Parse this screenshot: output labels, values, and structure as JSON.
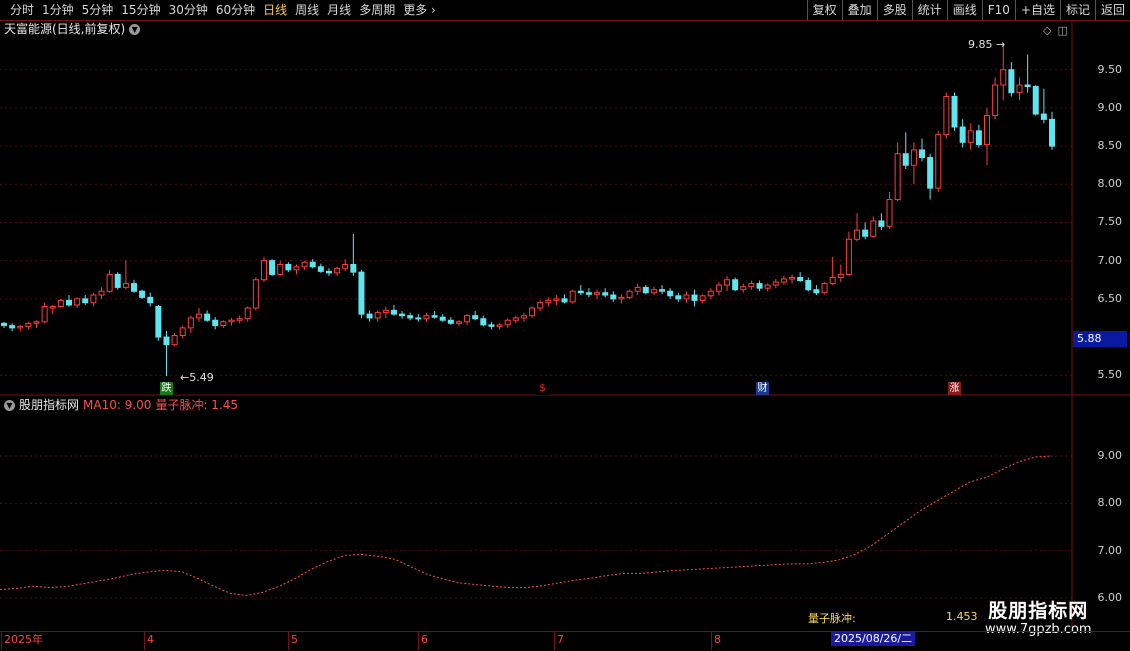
{
  "toolbar": {
    "periods": [
      "分时",
      "1分钟",
      "5分钟",
      "15分钟",
      "30分钟",
      "60分钟",
      "日线",
      "周线",
      "月线",
      "多周期",
      "更多"
    ],
    "active_period": "日线",
    "right_buttons": [
      "复权",
      "叠加",
      "多股",
      "统计",
      "画线",
      "F10",
      "+自选",
      "标记",
      "返回"
    ]
  },
  "chart_header": {
    "title": "天富能源(日线,前复权)"
  },
  "indicator_header": {
    "name": "股朋指标网",
    "ma_label": "MA10: 9.00",
    "qz_label": "量子脉冲: 1.45"
  },
  "price_axis": [
    "9.50",
    "9.00",
    "8.50",
    "8.00",
    "7.50",
    "7.00",
    "6.50",
    "5.50"
  ],
  "indicator_axis": [
    "9.00",
    "8.00",
    "7.00",
    "6.00"
  ],
  "last_price_box": "5.88",
  "annotations": {
    "high": "9.85",
    "low": "5.49"
  },
  "badges": [
    {
      "text": "跌",
      "bg": "#1a7a1a",
      "color": "#ffffff"
    },
    {
      "text": "$",
      "bg": "#000000",
      "color": "#ff3030"
    },
    {
      "text": "财",
      "bg": "#1a3a8a",
      "color": "#ffffff"
    },
    {
      "text": "涨",
      "bg": "#8a1a1a",
      "color": "#ffffff"
    }
  ],
  "date_axis": [
    "2025年",
    "4",
    "5",
    "6",
    "7",
    "8"
  ],
  "date_cursor": "2025/08/26/二",
  "qz_readout": {
    "label": "量子脉冲:",
    "value": "1.453"
  },
  "watermark": {
    "line1": "股朋指标网",
    "line2": "www.7gpzb.com"
  },
  "colors": {
    "up": "#ff3b3b",
    "down": "#5ee6f0",
    "ma": "#ff4d4d",
    "grid": "#5a0a0a"
  },
  "chart_data": {
    "type": "candlestick",
    "ohlc": [
      [
        6.18,
        6.2,
        6.12,
        6.15
      ],
      [
        6.15,
        6.18,
        6.08,
        6.12
      ],
      [
        6.12,
        6.16,
        6.08,
        6.14
      ],
      [
        6.14,
        6.2,
        6.1,
        6.18
      ],
      [
        6.18,
        6.22,
        6.12,
        6.2
      ],
      [
        6.2,
        6.45,
        6.18,
        6.4
      ],
      [
        6.38,
        6.42,
        6.3,
        6.4
      ],
      [
        6.4,
        6.5,
        6.38,
        6.48
      ],
      [
        6.48,
        6.55,
        6.4,
        6.42
      ],
      [
        6.42,
        6.52,
        6.38,
        6.5
      ],
      [
        6.5,
        6.55,
        6.42,
        6.45
      ],
      [
        6.45,
        6.58,
        6.4,
        6.55
      ],
      [
        6.55,
        6.65,
        6.5,
        6.6
      ],
      [
        6.6,
        6.88,
        6.58,
        6.82
      ],
      [
        6.82,
        6.85,
        6.62,
        6.65
      ],
      [
        6.65,
        7.0,
        6.62,
        6.7
      ],
      [
        6.7,
        6.75,
        6.58,
        6.6
      ],
      [
        6.6,
        6.62,
        6.5,
        6.52
      ],
      [
        6.52,
        6.58,
        6.4,
        6.45
      ],
      [
        6.4,
        6.42,
        5.95,
        6.0
      ],
      [
        6.0,
        6.08,
        5.49,
        5.9
      ],
      [
        5.9,
        6.05,
        5.88,
        6.02
      ],
      [
        6.02,
        6.15,
        5.98,
        6.12
      ],
      [
        6.12,
        6.28,
        6.05,
        6.25
      ],
      [
        6.25,
        6.38,
        6.2,
        6.3
      ],
      [
        6.3,
        6.35,
        6.2,
        6.22
      ],
      [
        6.22,
        6.26,
        6.1,
        6.15
      ],
      [
        6.15,
        6.22,
        6.12,
        6.2
      ],
      [
        6.2,
        6.25,
        6.15,
        6.22
      ],
      [
        6.22,
        6.28,
        6.18,
        6.24
      ],
      [
        6.24,
        6.4,
        6.2,
        6.38
      ],
      [
        6.38,
        6.78,
        6.35,
        6.75
      ],
      [
        6.75,
        7.05,
        6.72,
        7.0
      ],
      [
        7.0,
        7.02,
        6.8,
        6.82
      ],
      [
        6.82,
        7.0,
        6.8,
        6.95
      ],
      [
        6.95,
        6.98,
        6.85,
        6.88
      ],
      [
        6.88,
        6.95,
        6.82,
        6.92
      ],
      [
        6.92,
        7.0,
        6.88,
        6.98
      ],
      [
        6.98,
        7.02,
        6.9,
        6.92
      ],
      [
        6.92,
        6.96,
        6.84,
        6.86
      ],
      [
        6.86,
        6.9,
        6.8,
        6.84
      ],
      [
        6.84,
        6.92,
        6.8,
        6.9
      ],
      [
        6.9,
        7.02,
        6.86,
        6.95
      ],
      [
        6.95,
        7.35,
        6.8,
        6.85
      ],
      [
        6.85,
        6.88,
        6.25,
        6.3
      ],
      [
        6.3,
        6.35,
        6.2,
        6.25
      ],
      [
        6.25,
        6.35,
        6.2,
        6.32
      ],
      [
        6.32,
        6.4,
        6.25,
        6.35
      ],
      [
        6.35,
        6.42,
        6.28,
        6.3
      ],
      [
        6.3,
        6.34,
        6.24,
        6.28
      ],
      [
        6.28,
        6.32,
        6.22,
        6.25
      ],
      [
        6.25,
        6.3,
        6.2,
        6.24
      ],
      [
        6.24,
        6.32,
        6.2,
        6.28
      ],
      [
        6.28,
        6.34,
        6.24,
        6.26
      ],
      [
        6.26,
        6.3,
        6.2,
        6.22
      ],
      [
        6.22,
        6.26,
        6.16,
        6.18
      ],
      [
        6.18,
        6.22,
        6.14,
        6.2
      ],
      [
        6.2,
        6.3,
        6.16,
        6.28
      ],
      [
        6.28,
        6.34,
        6.22,
        6.24
      ],
      [
        6.24,
        6.28,
        6.14,
        6.16
      ],
      [
        6.16,
        6.2,
        6.1,
        6.14
      ],
      [
        6.14,
        6.18,
        6.1,
        6.16
      ],
      [
        6.16,
        6.24,
        6.12,
        6.22
      ],
      [
        6.22,
        6.28,
        6.18,
        6.25
      ],
      [
        6.25,
        6.32,
        6.2,
        6.28
      ],
      [
        6.28,
        6.4,
        6.25,
        6.38
      ],
      [
        6.38,
        6.48,
        6.34,
        6.45
      ],
      [
        6.45,
        6.52,
        6.4,
        6.48
      ],
      [
        6.48,
        6.55,
        6.42,
        6.5
      ],
      [
        6.5,
        6.56,
        6.44,
        6.46
      ],
      [
        6.46,
        6.62,
        6.44,
        6.6
      ],
      [
        6.6,
        6.68,
        6.55,
        6.58
      ],
      [
        6.58,
        6.64,
        6.52,
        6.56
      ],
      [
        6.56,
        6.62,
        6.5,
        6.58
      ],
      [
        6.58,
        6.64,
        6.52,
        6.55
      ],
      [
        6.55,
        6.6,
        6.46,
        6.5
      ],
      [
        6.5,
        6.56,
        6.44,
        6.52
      ],
      [
        6.52,
        6.62,
        6.5,
        6.6
      ],
      [
        6.6,
        6.7,
        6.55,
        6.65
      ],
      [
        6.65,
        6.68,
        6.56,
        6.58
      ],
      [
        6.58,
        6.66,
        6.55,
        6.62
      ],
      [
        6.62,
        6.68,
        6.56,
        6.6
      ],
      [
        6.6,
        6.64,
        6.5,
        6.54
      ],
      [
        6.54,
        6.58,
        6.46,
        6.5
      ],
      [
        6.5,
        6.6,
        6.45,
        6.55
      ],
      [
        6.55,
        6.62,
        6.4,
        6.48
      ],
      [
        6.48,
        6.56,
        6.44,
        6.54
      ],
      [
        6.54,
        6.64,
        6.5,
        6.6
      ],
      [
        6.6,
        6.72,
        6.55,
        6.68
      ],
      [
        6.68,
        6.8,
        6.6,
        6.75
      ],
      [
        6.75,
        6.78,
        6.6,
        6.62
      ],
      [
        6.62,
        6.7,
        6.58,
        6.66
      ],
      [
        6.66,
        6.74,
        6.62,
        6.7
      ],
      [
        6.7,
        6.74,
        6.6,
        6.64
      ],
      [
        6.64,
        6.7,
        6.6,
        6.68
      ],
      [
        6.68,
        6.76,
        6.64,
        6.72
      ],
      [
        6.72,
        6.8,
        6.68,
        6.76
      ],
      [
        6.76,
        6.82,
        6.7,
        6.78
      ],
      [
        6.78,
        6.85,
        6.72,
        6.74
      ],
      [
        6.74,
        6.78,
        6.6,
        6.62
      ],
      [
        6.62,
        6.68,
        6.55,
        6.58
      ],
      [
        6.58,
        6.72,
        6.56,
        6.7
      ],
      [
        6.7,
        7.05,
        6.68,
        6.78
      ],
      [
        6.78,
        6.95,
        6.72,
        6.82
      ],
      [
        6.82,
        7.38,
        6.8,
        7.28
      ],
      [
        7.28,
        7.62,
        7.25,
        7.4
      ],
      [
        7.4,
        7.5,
        7.28,
        7.32
      ],
      [
        7.32,
        7.58,
        7.3,
        7.52
      ],
      [
        7.52,
        7.62,
        7.4,
        7.45
      ],
      [
        7.45,
        7.9,
        7.42,
        7.8
      ],
      [
        7.8,
        8.55,
        7.78,
        8.4
      ],
      [
        8.4,
        8.68,
        8.2,
        8.25
      ],
      [
        8.25,
        8.55,
        8.0,
        8.45
      ],
      [
        8.45,
        8.6,
        8.3,
        8.35
      ],
      [
        8.35,
        8.4,
        7.8,
        7.95
      ],
      [
        7.95,
        8.7,
        7.9,
        8.65
      ],
      [
        8.65,
        9.2,
        8.6,
        9.15
      ],
      [
        9.15,
        9.2,
        8.7,
        8.75
      ],
      [
        8.75,
        8.85,
        8.48,
        8.55
      ],
      [
        8.55,
        8.8,
        8.45,
        8.7
      ],
      [
        8.7,
        8.78,
        8.48,
        8.52
      ],
      [
        8.52,
        9.0,
        8.25,
        8.9
      ],
      [
        8.9,
        9.4,
        8.85,
        9.3
      ],
      [
        9.3,
        9.85,
        9.1,
        9.5
      ],
      [
        9.5,
        9.6,
        9.15,
        9.2
      ],
      [
        9.2,
        9.4,
        9.1,
        9.3
      ],
      [
        9.3,
        9.7,
        9.2,
        9.28
      ],
      [
        9.28,
        9.3,
        8.9,
        8.92
      ],
      [
        8.92,
        9.25,
        8.8,
        8.85
      ],
      [
        8.85,
        8.95,
        8.45,
        8.5
      ]
    ],
    "ma10": [
      6.18,
      6.2,
      6.25,
      6.22,
      6.24,
      6.3,
      6.36,
      6.42,
      6.5,
      6.55,
      6.58,
      6.56,
      6.42,
      6.25,
      6.1,
      6.05,
      6.12,
      6.25,
      6.42,
      6.62,
      6.78,
      6.9,
      6.92,
      6.88,
      6.82,
      6.66,
      6.5,
      6.4,
      6.32,
      6.28,
      6.25,
      6.22,
      6.22,
      6.26,
      6.32,
      6.38,
      6.42,
      6.48,
      6.52,
      6.52,
      6.55,
      6.58,
      6.6,
      6.62,
      6.64,
      6.66,
      6.68,
      6.7,
      6.72,
      6.72,
      6.75,
      6.8,
      6.92,
      7.1,
      7.35,
      7.6,
      7.85,
      8.05,
      8.25,
      8.45,
      8.55,
      8.72,
      8.88,
      8.98,
      9.0
    ]
  }
}
